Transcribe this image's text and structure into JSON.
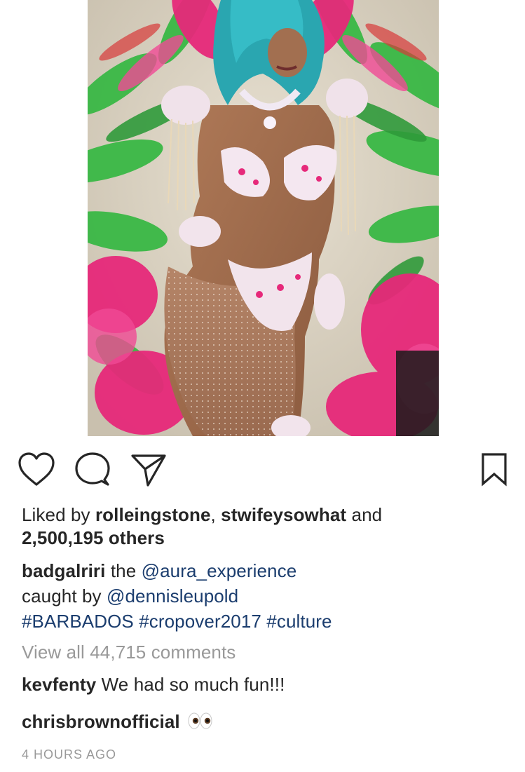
{
  "post": {
    "image_alt": "Carnival costume photo",
    "colors": {
      "text": "#262626",
      "link": "#1b3d6e",
      "muted": "#999999",
      "feather_green": "#3fbf3f",
      "feather_pink": "#e6297a",
      "hair": "#2aa6b0"
    }
  },
  "actions": {
    "like_icon": "heart-icon",
    "comment_icon": "speech-bubble-icon",
    "share_icon": "paper-plane-icon",
    "save_icon": "bookmark-icon"
  },
  "likes": {
    "prefix": "Liked by",
    "user1": "rolleingstone",
    "separator": ",",
    "user2": "stwifeysowhat",
    "conjunction": "and",
    "count": "2,500,195 others"
  },
  "caption": {
    "username": "badgalriri",
    "text1": "the",
    "mention1": "@aura_experience",
    "text2": "caught by",
    "mention2": "@dennisleupold",
    "hashtag1": "#BARBADOS",
    "hashtag2": "#cropover2017",
    "hashtag3": "#culture"
  },
  "view_all_comments": "View all 44,715 comments",
  "comments": [
    {
      "username": "kevfenty",
      "text": "We had so much fun!!!"
    },
    {
      "username": "chrisbrownofficial",
      "text": "",
      "emoji": "eyes-emoji"
    }
  ],
  "timestamp": "4 HOURS AGO"
}
